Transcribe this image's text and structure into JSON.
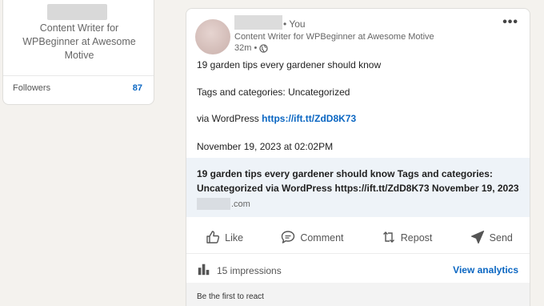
{
  "profile_card": {
    "headline": "Content Writer for WPBeginner at Awesome Motive",
    "followers_label": "Followers",
    "followers_count": "87"
  },
  "post": {
    "you_label": "• You",
    "author_headline": "Content Writer for WPBeginner at Awesome Motive",
    "time": "32m •",
    "more_label": "•••",
    "title_line": "19 garden tips every gardener should know",
    "tags_line": "Tags and categories: Uncategorized",
    "via_prefix": "via WordPress",
    "link": "https://ift.tt/ZdD8K73",
    "date_line": "November 19, 2023 at 02:02PM",
    "preview_title": "19 garden tips every gardener should know Tags and categories: Uncategorized via WordPress https://ift.tt/ZdD8K73 November 19, 2023 ...",
    "preview_domain_suffix": ".com"
  },
  "actions": {
    "like": "Like",
    "comment": "Comment",
    "repost": "Repost",
    "send": "Send"
  },
  "stats": {
    "impressions": "15 impressions",
    "view_analytics": "View analytics",
    "first_react": "Be the first to react"
  },
  "icons": {
    "visibility": "globe-icon",
    "impressions": "bar-chart-icon",
    "like": "thumbs-up-icon",
    "comment": "comment-icon",
    "repost": "repost-icon",
    "send": "send-icon"
  },
  "colors": {
    "link_blue": "#0a66c2",
    "page_bg": "#f4f2ee",
    "preview_bg": "#eef3f8"
  }
}
